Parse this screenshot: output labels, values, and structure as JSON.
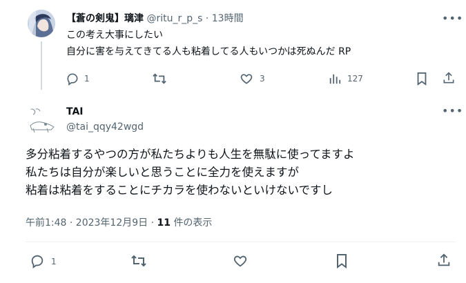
{
  "parent_tweet": {
    "display_name": "【蒼の剣鬼】璃津",
    "handle": "@ritu_r_p_s",
    "separator": "·",
    "time_ago": "13時間",
    "text_line1": "この考え大事にしたい",
    "text_line2": "自分に害を与えてきてる人も粘着してる人もいつかは死ぬんだ RP",
    "actions": {
      "reply_count": "1",
      "retweet_count": "",
      "like_count": "3",
      "view_count": "127"
    }
  },
  "main_tweet": {
    "display_name": "TAI",
    "handle": "@tai_qqy42wgd",
    "text_line1": "多分粘着するやつの方が私たちよりも人生を無駄に使ってますよ",
    "text_line2": "私たちは自分が楽しいと思うことに全力を使えますが",
    "text_line3": "粘着は粘着をすることにチカラを使わないといけないですし",
    "timestamp": "午前1:48 · 2023年12月9日",
    "meta_separator": "·",
    "view_count": "11",
    "view_label": "件の表示",
    "actions": {
      "reply_count": "1"
    }
  },
  "icons": {
    "reply": "reply-icon",
    "retweet": "retweet-icon",
    "like": "heart-icon",
    "views": "views-icon",
    "bookmark": "bookmark-icon",
    "share": "share-icon",
    "more": "more-icon"
  },
  "colors": {
    "text": "#0f1419",
    "secondary": "#536471",
    "divider": "#eff3f4",
    "thread_line": "#cfd9de"
  }
}
